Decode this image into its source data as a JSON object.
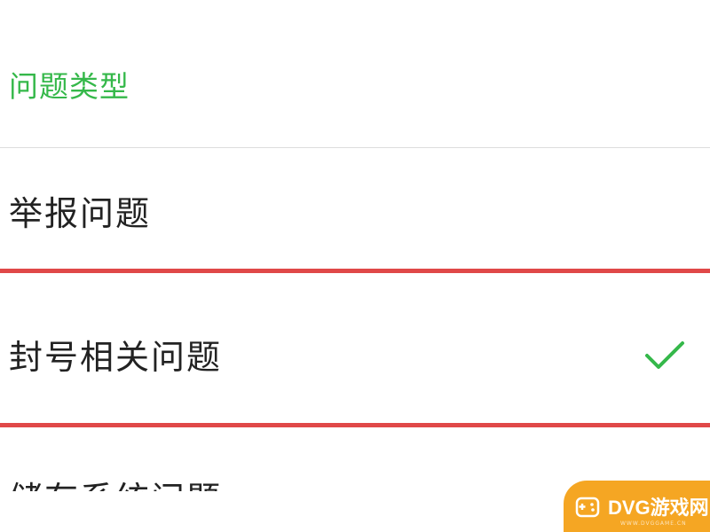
{
  "section": {
    "title": "问题类型",
    "title_color": "#35b84a"
  },
  "options": [
    {
      "label": "举报问题",
      "selected": false
    },
    {
      "label": "封号相关问题",
      "selected": true
    },
    {
      "label": "储存系统问题",
      "selected": false,
      "clipped": true
    }
  ],
  "highlight": {
    "color": "#e04848"
  },
  "check": {
    "icon": "check-icon",
    "color": "#35b84a"
  },
  "watermark": {
    "text": "DVG游戏网",
    "sub": "WWW.DVGGAME.CN",
    "color": "#f5a623",
    "icon": "gamepad-icon"
  }
}
